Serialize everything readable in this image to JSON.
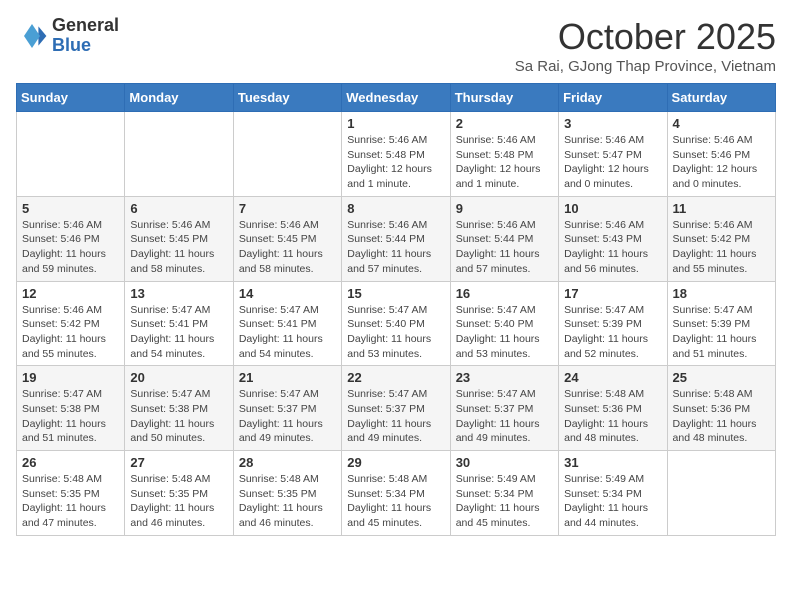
{
  "header": {
    "logo_general": "General",
    "logo_blue": "Blue",
    "month_title": "October 2025",
    "subtitle": "Sa Rai, GJong Thap Province, Vietnam"
  },
  "days_of_week": [
    "Sunday",
    "Monday",
    "Tuesday",
    "Wednesday",
    "Thursday",
    "Friday",
    "Saturday"
  ],
  "weeks": [
    [
      {
        "day": "",
        "info": ""
      },
      {
        "day": "",
        "info": ""
      },
      {
        "day": "",
        "info": ""
      },
      {
        "day": "1",
        "info": "Sunrise: 5:46 AM\nSunset: 5:48 PM\nDaylight: 12 hours\nand 1 minute."
      },
      {
        "day": "2",
        "info": "Sunrise: 5:46 AM\nSunset: 5:48 PM\nDaylight: 12 hours\nand 1 minute."
      },
      {
        "day": "3",
        "info": "Sunrise: 5:46 AM\nSunset: 5:47 PM\nDaylight: 12 hours\nand 0 minutes."
      },
      {
        "day": "4",
        "info": "Sunrise: 5:46 AM\nSunset: 5:46 PM\nDaylight: 12 hours\nand 0 minutes."
      }
    ],
    [
      {
        "day": "5",
        "info": "Sunrise: 5:46 AM\nSunset: 5:46 PM\nDaylight: 11 hours\nand 59 minutes."
      },
      {
        "day": "6",
        "info": "Sunrise: 5:46 AM\nSunset: 5:45 PM\nDaylight: 11 hours\nand 58 minutes."
      },
      {
        "day": "7",
        "info": "Sunrise: 5:46 AM\nSunset: 5:45 PM\nDaylight: 11 hours\nand 58 minutes."
      },
      {
        "day": "8",
        "info": "Sunrise: 5:46 AM\nSunset: 5:44 PM\nDaylight: 11 hours\nand 57 minutes."
      },
      {
        "day": "9",
        "info": "Sunrise: 5:46 AM\nSunset: 5:44 PM\nDaylight: 11 hours\nand 57 minutes."
      },
      {
        "day": "10",
        "info": "Sunrise: 5:46 AM\nSunset: 5:43 PM\nDaylight: 11 hours\nand 56 minutes."
      },
      {
        "day": "11",
        "info": "Sunrise: 5:46 AM\nSunset: 5:42 PM\nDaylight: 11 hours\nand 55 minutes."
      }
    ],
    [
      {
        "day": "12",
        "info": "Sunrise: 5:46 AM\nSunset: 5:42 PM\nDaylight: 11 hours\nand 55 minutes."
      },
      {
        "day": "13",
        "info": "Sunrise: 5:47 AM\nSunset: 5:41 PM\nDaylight: 11 hours\nand 54 minutes."
      },
      {
        "day": "14",
        "info": "Sunrise: 5:47 AM\nSunset: 5:41 PM\nDaylight: 11 hours\nand 54 minutes."
      },
      {
        "day": "15",
        "info": "Sunrise: 5:47 AM\nSunset: 5:40 PM\nDaylight: 11 hours\nand 53 minutes."
      },
      {
        "day": "16",
        "info": "Sunrise: 5:47 AM\nSunset: 5:40 PM\nDaylight: 11 hours\nand 53 minutes."
      },
      {
        "day": "17",
        "info": "Sunrise: 5:47 AM\nSunset: 5:39 PM\nDaylight: 11 hours\nand 52 minutes."
      },
      {
        "day": "18",
        "info": "Sunrise: 5:47 AM\nSunset: 5:39 PM\nDaylight: 11 hours\nand 51 minutes."
      }
    ],
    [
      {
        "day": "19",
        "info": "Sunrise: 5:47 AM\nSunset: 5:38 PM\nDaylight: 11 hours\nand 51 minutes."
      },
      {
        "day": "20",
        "info": "Sunrise: 5:47 AM\nSunset: 5:38 PM\nDaylight: 11 hours\nand 50 minutes."
      },
      {
        "day": "21",
        "info": "Sunrise: 5:47 AM\nSunset: 5:37 PM\nDaylight: 11 hours\nand 49 minutes."
      },
      {
        "day": "22",
        "info": "Sunrise: 5:47 AM\nSunset: 5:37 PM\nDaylight: 11 hours\nand 49 minutes."
      },
      {
        "day": "23",
        "info": "Sunrise: 5:47 AM\nSunset: 5:37 PM\nDaylight: 11 hours\nand 49 minutes."
      },
      {
        "day": "24",
        "info": "Sunrise: 5:48 AM\nSunset: 5:36 PM\nDaylight: 11 hours\nand 48 minutes."
      },
      {
        "day": "25",
        "info": "Sunrise: 5:48 AM\nSunset: 5:36 PM\nDaylight: 11 hours\nand 48 minutes."
      }
    ],
    [
      {
        "day": "26",
        "info": "Sunrise: 5:48 AM\nSunset: 5:35 PM\nDaylight: 11 hours\nand 47 minutes."
      },
      {
        "day": "27",
        "info": "Sunrise: 5:48 AM\nSunset: 5:35 PM\nDaylight: 11 hours\nand 46 minutes."
      },
      {
        "day": "28",
        "info": "Sunrise: 5:48 AM\nSunset: 5:35 PM\nDaylight: 11 hours\nand 46 minutes."
      },
      {
        "day": "29",
        "info": "Sunrise: 5:48 AM\nSunset: 5:34 PM\nDaylight: 11 hours\nand 45 minutes."
      },
      {
        "day": "30",
        "info": "Sunrise: 5:49 AM\nSunset: 5:34 PM\nDaylight: 11 hours\nand 45 minutes."
      },
      {
        "day": "31",
        "info": "Sunrise: 5:49 AM\nSunset: 5:34 PM\nDaylight: 11 hours\nand 44 minutes."
      },
      {
        "day": "",
        "info": ""
      }
    ]
  ]
}
